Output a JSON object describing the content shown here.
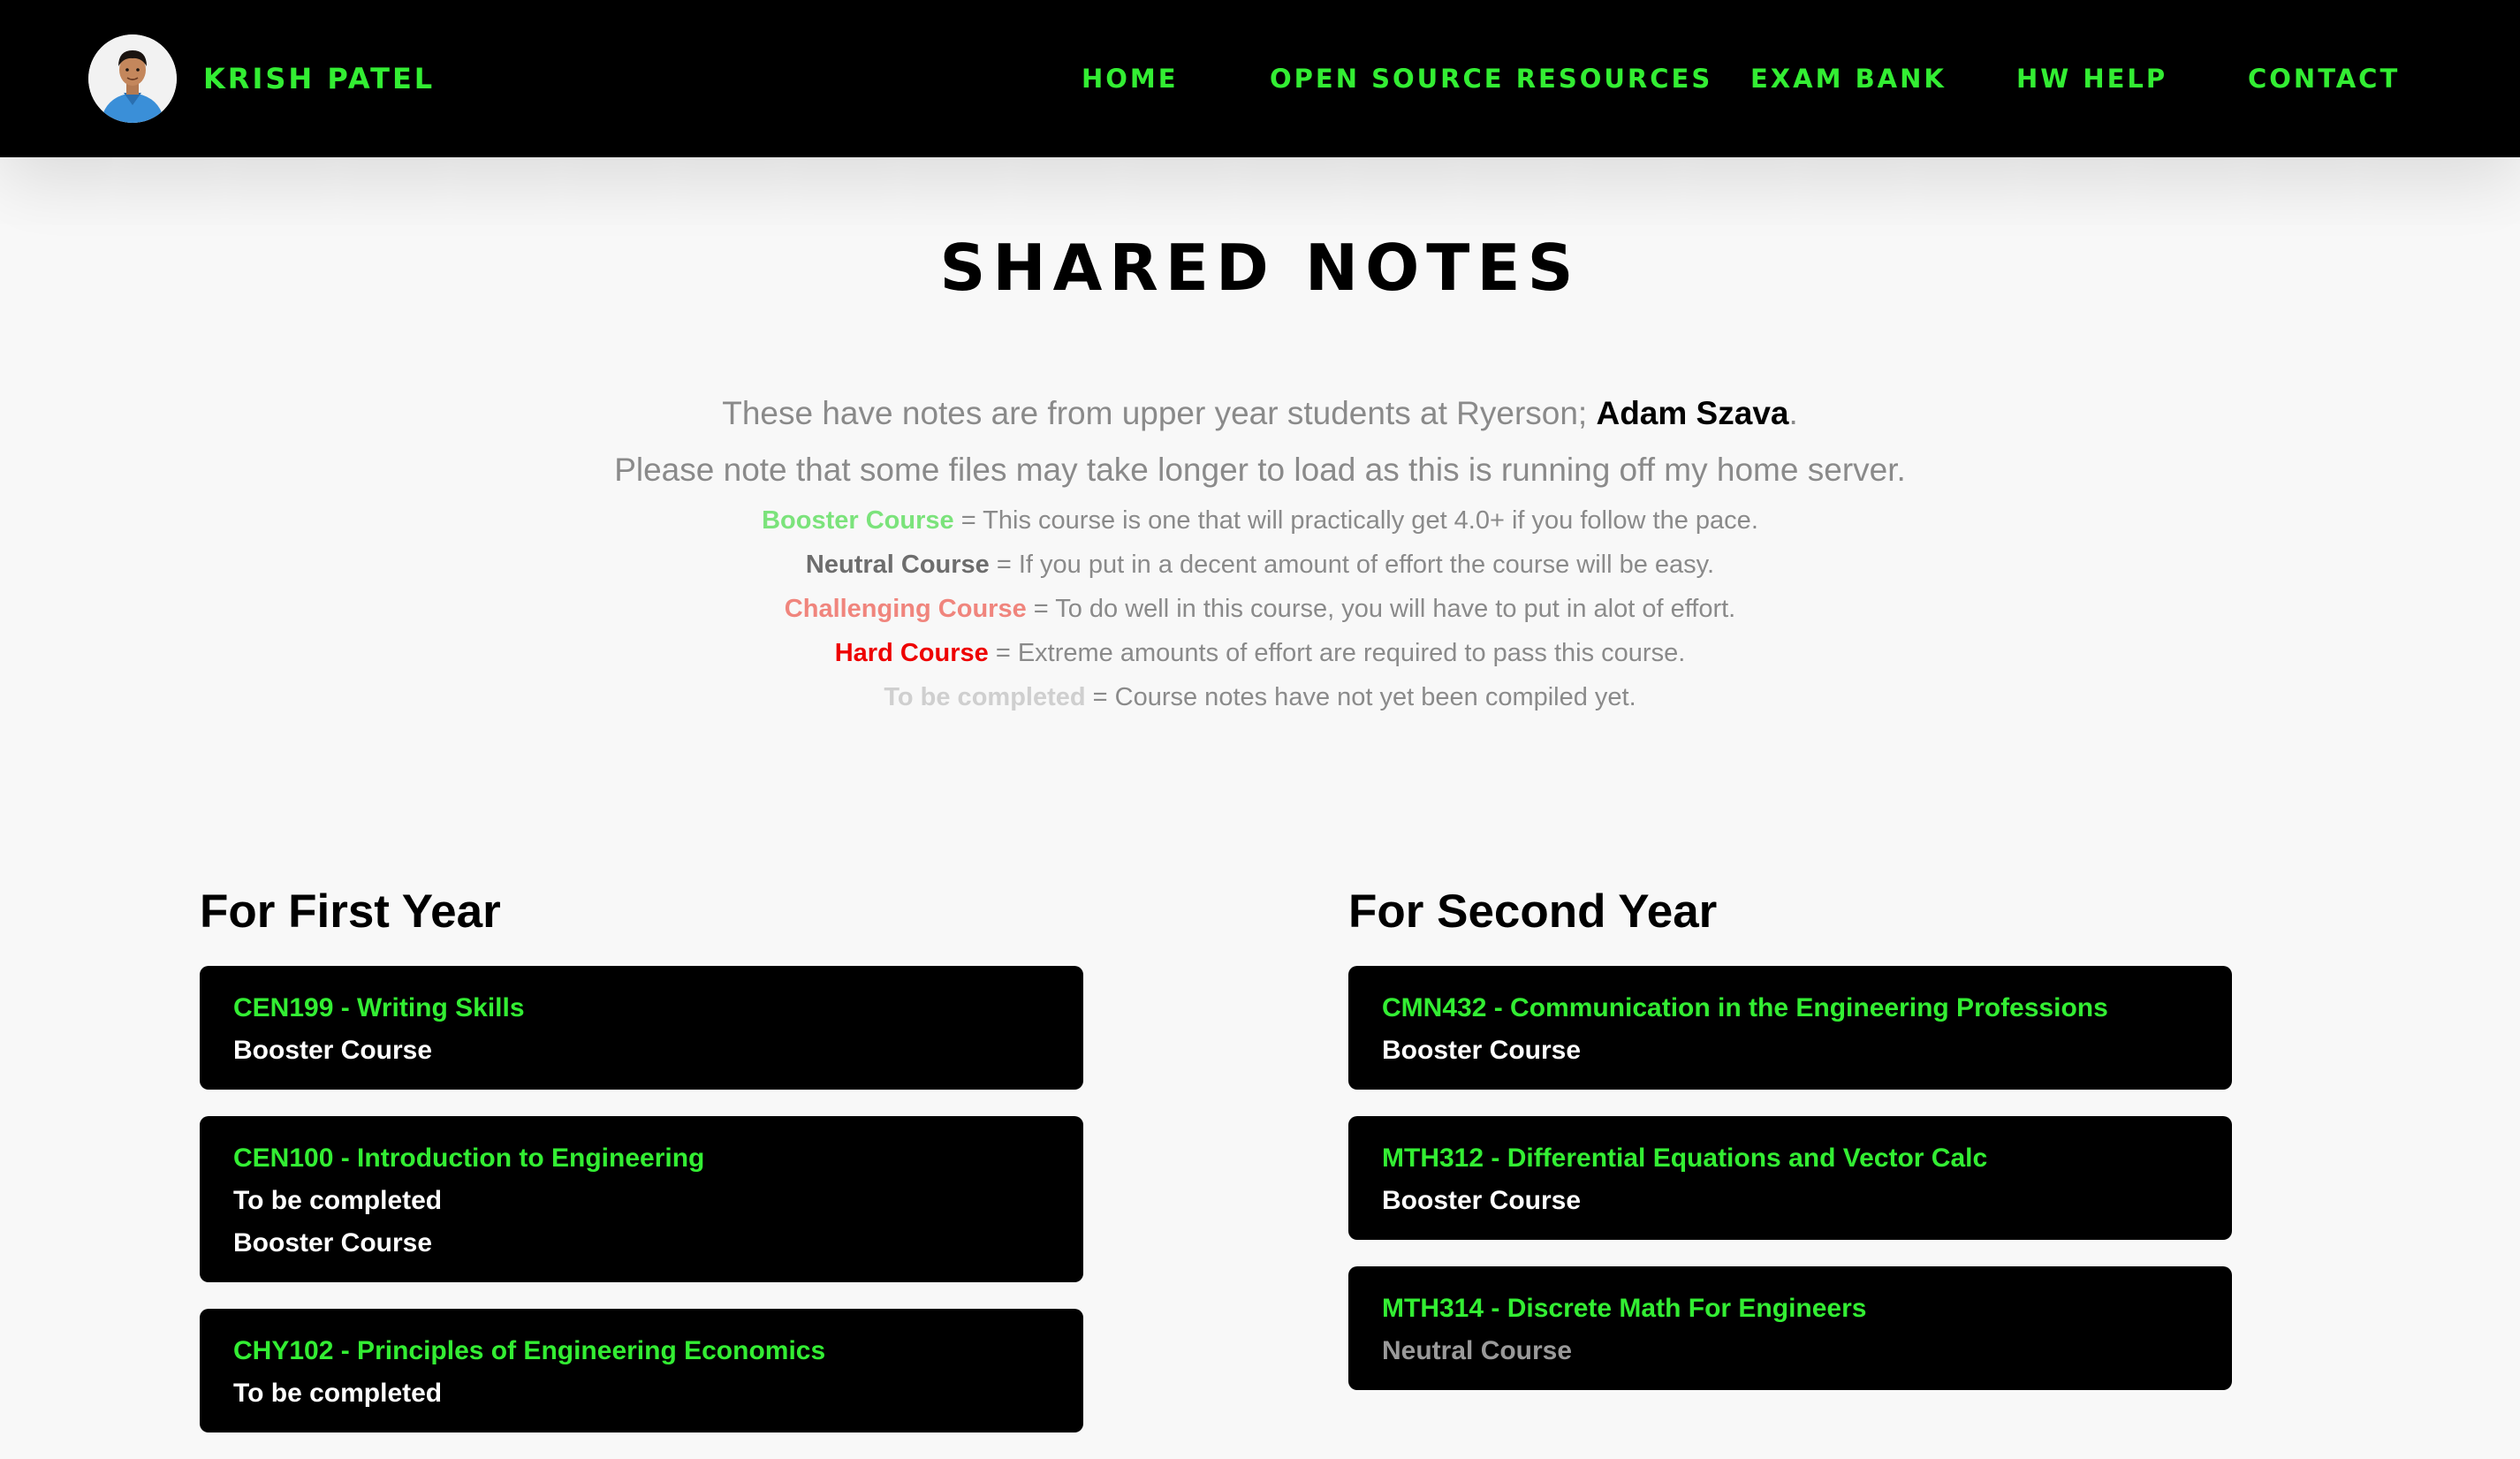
{
  "header": {
    "brand_name": "KRISH PATEL",
    "nav": [
      {
        "label": "HOME"
      },
      {
        "label": "OPEN SOURCE RESOURCES"
      },
      {
        "label": "EXAM BANK"
      },
      {
        "label": "HW HELP"
      },
      {
        "label": "CONTACT"
      }
    ]
  },
  "main": {
    "title": "SHARED NOTES",
    "intro_line1_prefix": "These have notes are from upper year students at Ryerson; ",
    "intro_author": "Adam Szava",
    "intro_line1_suffix": ".",
    "intro_line2": "Please note that some files may take longer to load as this is running off my home server.",
    "legend": [
      {
        "term": "Booster Course",
        "desc": " = This course is one that will practically get 4.0+ if you follow the pace.",
        "color": "#7be37b"
      },
      {
        "term": "Neutral Course",
        "desc": " = If you put in a decent amount of effort the course will be easy.",
        "color": "#6d6d6d"
      },
      {
        "term": "Challenging Course",
        "desc": " = To do well in this course, you will have to put in alot of effort.",
        "color": "#f0857d"
      },
      {
        "term": "Hard Course",
        "desc": " = Extreme amounts of effort are required to pass this course.",
        "color": "#ee0000"
      },
      {
        "term": "To be completed",
        "desc": " = Course notes have not yet been compiled yet.",
        "color": "#cfcfcf"
      }
    ]
  },
  "first_year": {
    "title": "For First Year",
    "courses": [
      {
        "name": "CEN199 - Writing Skills",
        "statuses": [
          "Booster Course"
        ]
      },
      {
        "name": "CEN100 - Introduction to Engineering",
        "statuses": [
          "To be completed",
          "Booster Course"
        ]
      },
      {
        "name": "CHY102 - Principles of Engineering Economics",
        "statuses": [
          "To be completed"
        ]
      }
    ]
  },
  "second_year": {
    "title": "For Second Year",
    "courses": [
      {
        "name": "CMN432 - Communication in the Engineering Professions",
        "statuses": [
          "Booster Course"
        ]
      },
      {
        "name": "MTH312 - Differential Equations and Vector Calc",
        "statuses": [
          "Booster Course"
        ]
      },
      {
        "name": "MTH314 - Discrete Math For Engineers",
        "statuses": [
          "Neutral Course"
        ]
      }
    ]
  },
  "colors": {
    "nav_accent": "#33ee33",
    "header_bg": "#000000",
    "page_bg": "#f8f8f8",
    "card_bg": "#000000"
  }
}
